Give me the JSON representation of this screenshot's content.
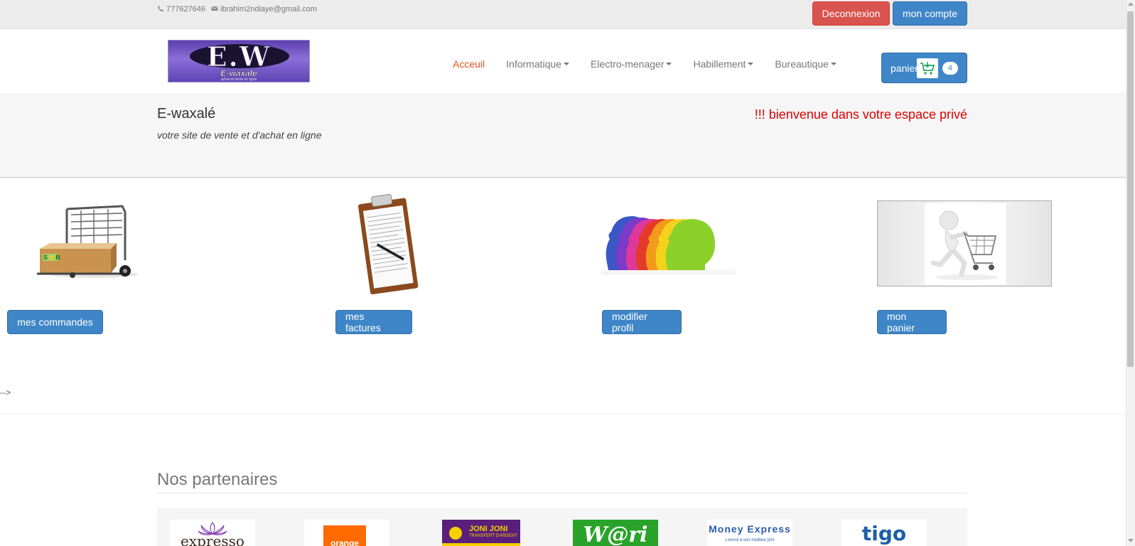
{
  "topbar": {
    "phone": "777627646",
    "email": "ibrahim2ndiaye@gmail.com",
    "logout_label": "Deconnexion",
    "account_label": "mon compte"
  },
  "logo": {
    "big": "E.W",
    "sub": "E-waxale",
    "tiny": "achat et vente en ligne"
  },
  "nav": {
    "items": [
      {
        "label": "Acceuil",
        "active": true
      },
      {
        "label": "Informatique",
        "dropdown": true
      },
      {
        "label": "Electro-menager",
        "dropdown": true
      },
      {
        "label": "Habillement",
        "dropdown": true
      },
      {
        "label": "Bureautique",
        "dropdown": true
      }
    ],
    "cart_label": "panier",
    "cart_count": "4"
  },
  "jumbo": {
    "title": "E-waxalé",
    "tagline": "votre site de vente et d'achat en ligne",
    "welcome": "!!! bienvenue dans votre espace privé"
  },
  "tiles": {
    "commandes": "mes commandes",
    "factures": "mes factures",
    "profil": "modifier profil",
    "panier": "mon panier"
  },
  "stray_text": "-->",
  "partners": {
    "title": "Nos partenaires",
    "logos": [
      "expresso",
      "orange",
      "JONI JONI",
      "W@ri",
      "Money Express",
      "tigo"
    ],
    "joni_sub": "TRANSFERT D'ARGENT",
    "money_sub": "L'envoi à son meilleur prix"
  },
  "colors": {
    "primary": "#3f86c8",
    "danger": "#d9534f",
    "accent": "#e2511a",
    "welcome": "#dd0000"
  }
}
